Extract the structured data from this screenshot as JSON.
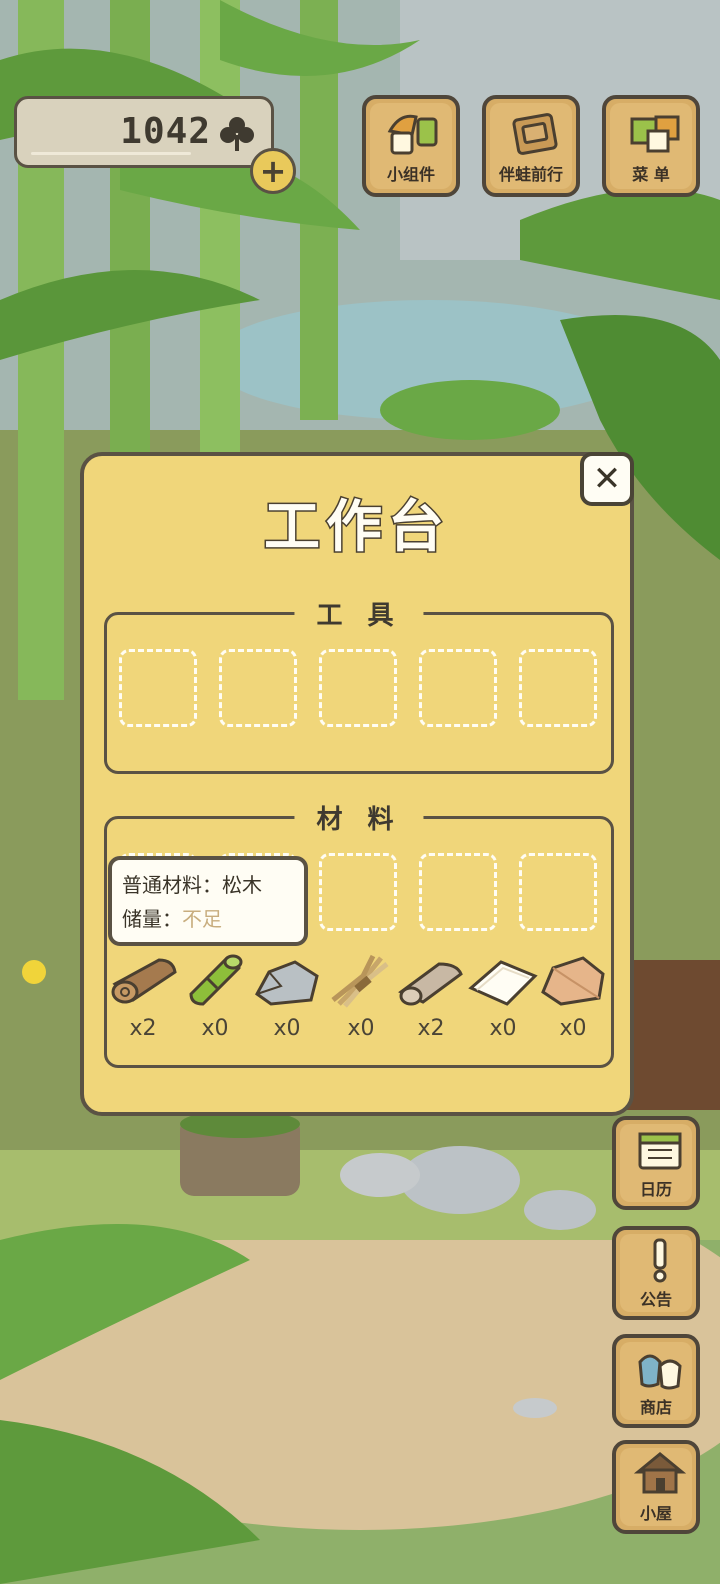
{
  "currency": {
    "amount": "1042",
    "icon": "clover-icon",
    "add_icon": "plus-icon"
  },
  "top_buttons": [
    {
      "label": "小组件",
      "icon": "widget-icon"
    },
    {
      "label": "伴蛙前行",
      "icon": "frog-journey-icon"
    },
    {
      "label": "菜 单",
      "icon": "menu-icon"
    }
  ],
  "side_buttons": [
    {
      "label": "日历",
      "icon": "calendar-icon"
    },
    {
      "label": "公告",
      "icon": "exclamation-icon"
    },
    {
      "label": "商店",
      "icon": "shop-bags-icon"
    },
    {
      "label": "小屋",
      "icon": "house-icon"
    }
  ],
  "workbench": {
    "title": "工作台",
    "tools_label": "工 具",
    "materials_label": "材 料",
    "tooltip": {
      "type_label": "普通材料：松木",
      "stock_label": "储量：",
      "stock_value": "不足"
    },
    "materials": [
      {
        "name": "pine-log-icon",
        "qty": "x2"
      },
      {
        "name": "bamboo-icon",
        "qty": "x0"
      },
      {
        "name": "stone-icon",
        "qty": "x0"
      },
      {
        "name": "straw-bundle-icon",
        "qty": "x0"
      },
      {
        "name": "cloth-roll-icon",
        "qty": "x2"
      },
      {
        "name": "paper-icon",
        "qty": "x0"
      },
      {
        "name": "clay-icon",
        "qty": "x0"
      }
    ]
  }
}
